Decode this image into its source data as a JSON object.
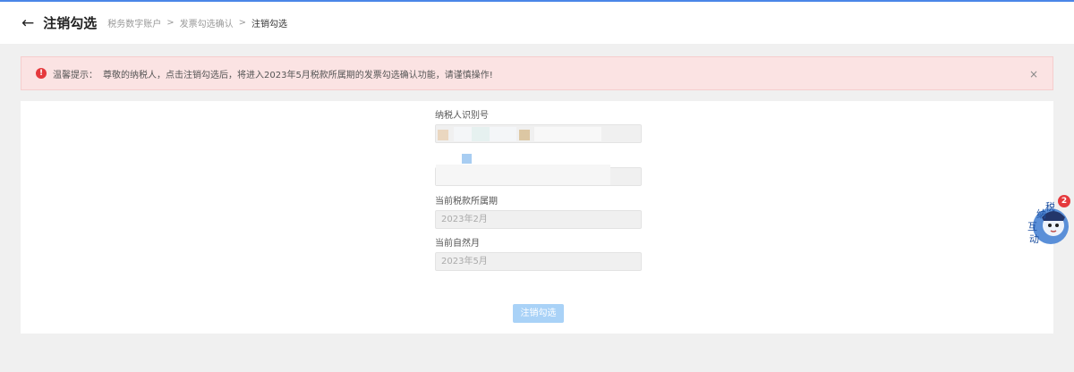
{
  "header": {
    "back_icon": "arrow-left-icon",
    "title": "注销勾选",
    "breadcrumb": [
      "税务数字账户",
      "发票勾选确认",
      "注销勾选"
    ],
    "separator": ">"
  },
  "alert": {
    "icon": "exclamation-icon",
    "icon_glyph": "!",
    "label": "温馨提示：",
    "message": "尊敬的纳税人，点击注销勾选后，将进入2023年5月税款所属期的发票勾选确认功能，请谨慎操作!",
    "close": "×",
    "color": "#fbe3e3"
  },
  "form": {
    "taxpayer_id_label": "纳税人识别号",
    "current_period_label": "当前税款所属期",
    "current_period_value": "2023年2月",
    "natural_month_label": "当前自然月",
    "natural_month_value": "2023年5月"
  },
  "submit": {
    "label": "注销勾选",
    "color": "#a9d2f7"
  },
  "assistant": {
    "icon": "tax-assistant-avatar-icon",
    "text": "纳税互动",
    "badge": "2"
  },
  "colors": {
    "accent": "#4a86e8",
    "alert_icon": "#e5393d",
    "page_bg": "#f0f0f0"
  }
}
